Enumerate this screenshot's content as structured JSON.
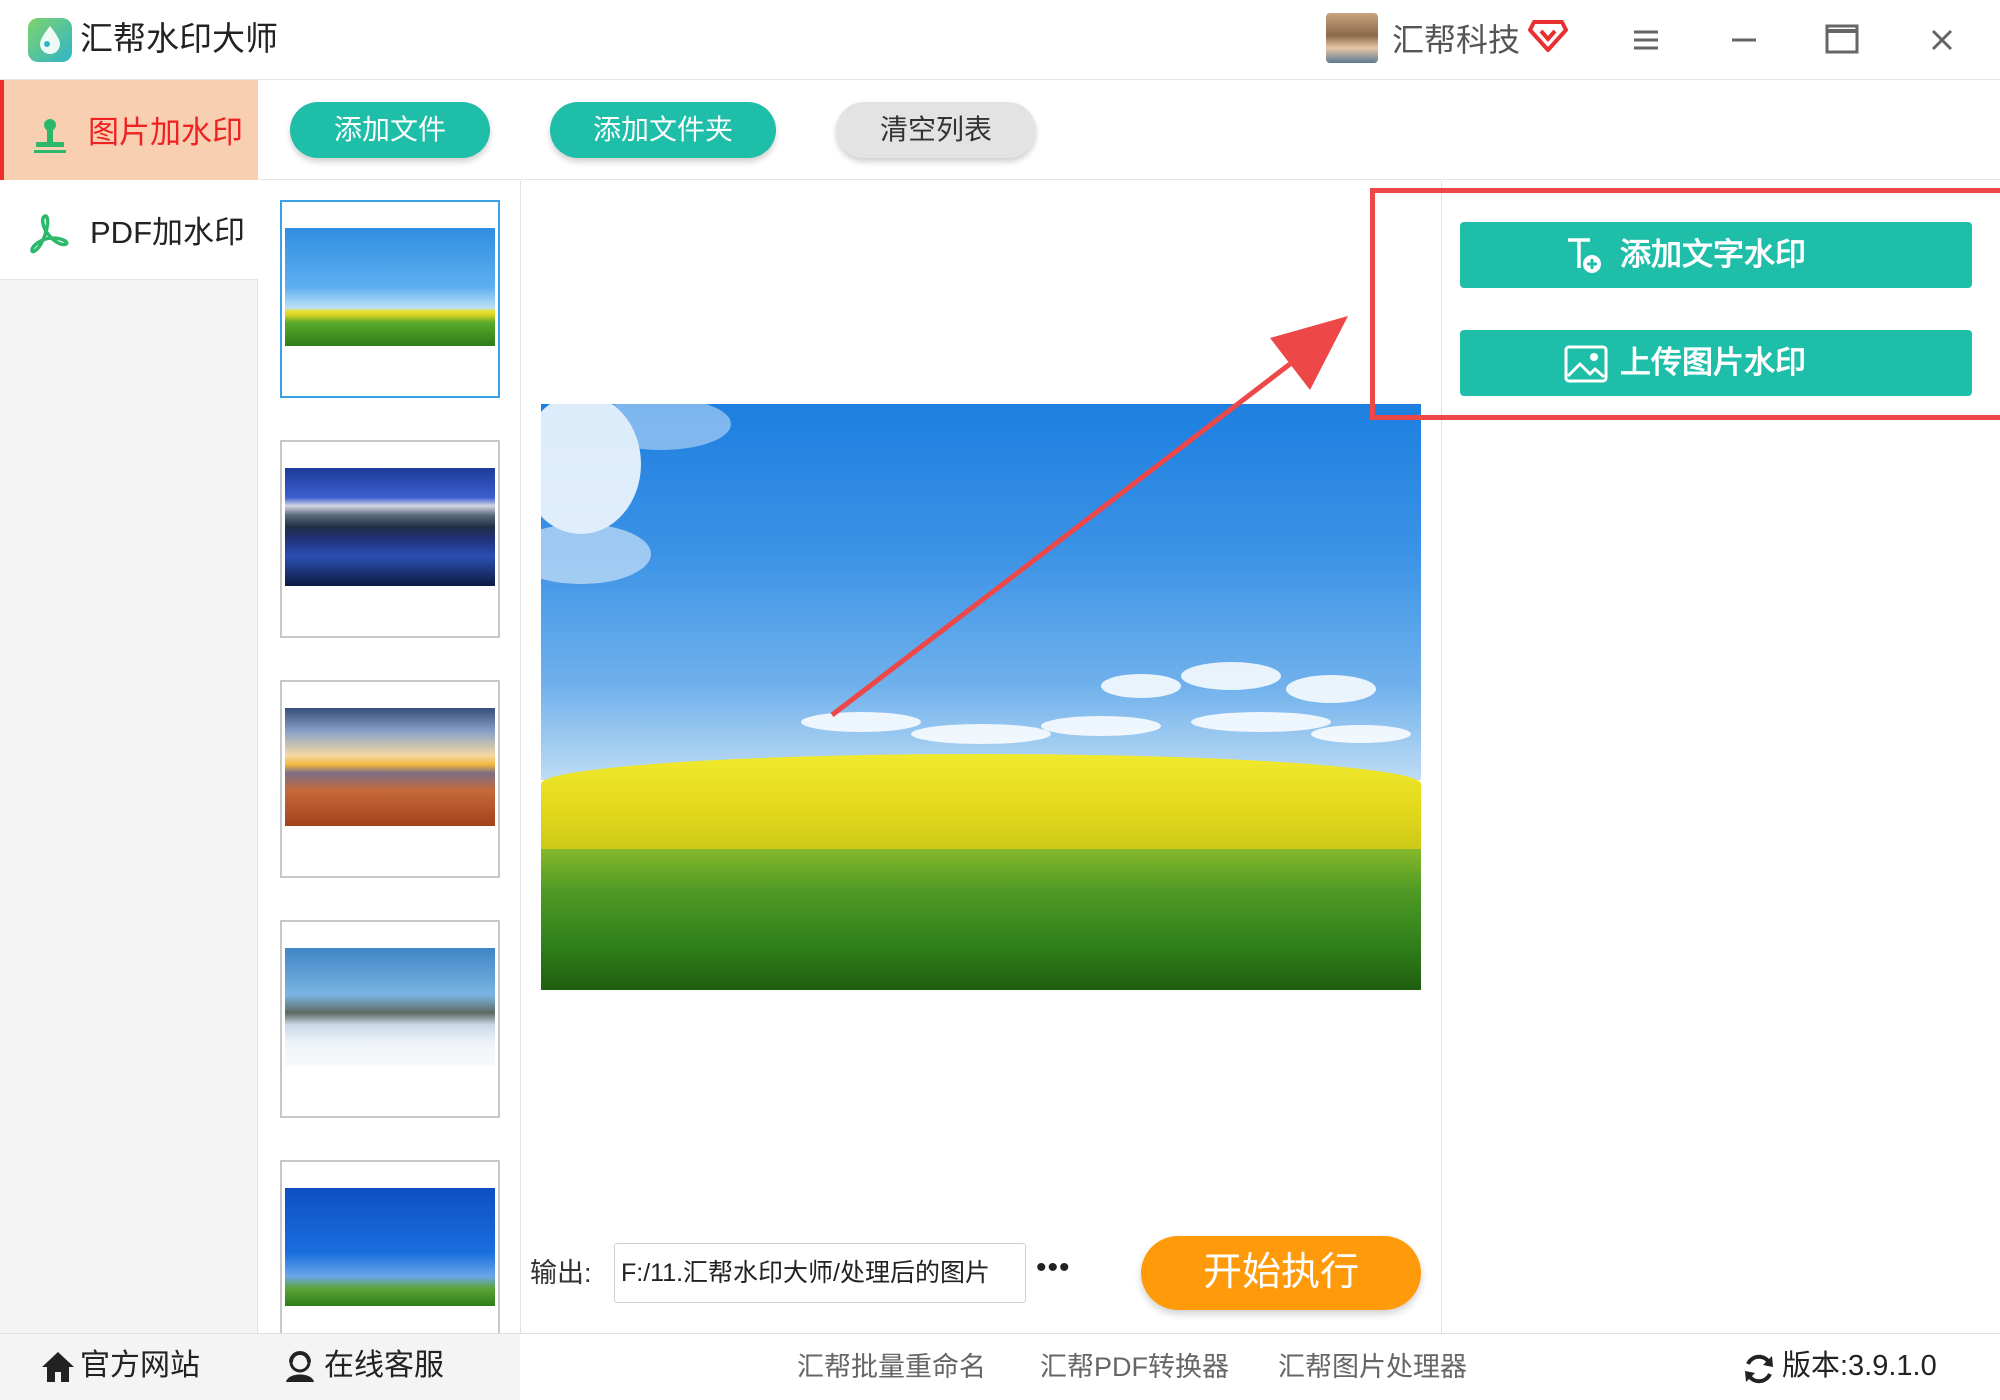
{
  "app": {
    "title": "汇帮水印大师",
    "user_name": "汇帮科技"
  },
  "sidebar": {
    "items": [
      {
        "label": "图片加水印",
        "active": true,
        "icon": "stamp-icon"
      },
      {
        "label": "PDF加水印",
        "active": false,
        "icon": "pdf-icon"
      }
    ]
  },
  "toolbar": {
    "add_file": "添加文件",
    "add_folder": "添加文件夹",
    "clear_list": "清空列表"
  },
  "thumbnails": [
    {
      "name": "meadow",
      "selected": true
    },
    {
      "name": "mountain-lake",
      "selected": false
    },
    {
      "name": "beach-sunset",
      "selected": false
    },
    {
      "name": "snow-trees",
      "selected": false
    },
    {
      "name": "tree-sky",
      "selected": false
    }
  ],
  "output": {
    "label": "输出:",
    "path": "F:/11.汇帮水印大师/处理后的图片",
    "more": "•••"
  },
  "start_button": "开始执行",
  "watermark": {
    "add_text": "添加文字水印",
    "upload_image": "上传图片水印"
  },
  "footer": {
    "official_site": "官方网站",
    "online_support": "在线客服",
    "links": [
      "汇帮批量重命名",
      "汇帮PDF转换器",
      "汇帮图片处理器"
    ],
    "version": "版本:3.9.1.0"
  },
  "colors": {
    "teal": "#1fbea9",
    "orange": "#ff9a0a",
    "accent_red": "#ee4747",
    "active_nav": "#f8cfb0"
  }
}
